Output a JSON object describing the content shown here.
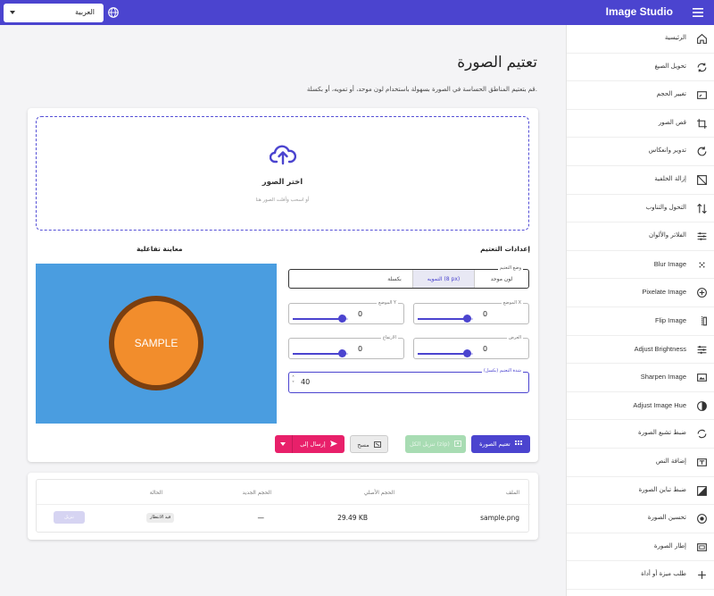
{
  "header": {
    "title": "Image Studio",
    "language": "العربية",
    "accent_color": "#4b44cf"
  },
  "sidebar": {
    "items": [
      {
        "label": "الرئيسية",
        "icon": "home-icon"
      },
      {
        "label": "تحويل الصيغ",
        "icon": "convert-icon"
      },
      {
        "label": "تغيير الحجم",
        "icon": "resize-icon"
      },
      {
        "label": "قص الصور",
        "icon": "crop-icon"
      },
      {
        "label": "تدوير وانعكاس",
        "icon": "rotate-icon"
      },
      {
        "label": "إزالة الخلفية",
        "icon": "background-remove-icon"
      },
      {
        "label": "التحول والتناوب",
        "icon": "transform-icon"
      },
      {
        "label": "الفلاتر والألوان",
        "icon": "filters-icon"
      },
      {
        "label": "Blur Image",
        "icon": "blur-icon"
      },
      {
        "label": "Pixelate Image",
        "icon": "pixelate-icon"
      },
      {
        "label": "Flip Image",
        "icon": "flip-icon"
      },
      {
        "label": "Adjust Brightness",
        "icon": "brightness-icon"
      },
      {
        "label": "Sharpen Image",
        "icon": "sharpen-icon"
      },
      {
        "label": "Adjust Image Hue",
        "icon": "hue-icon"
      },
      {
        "label": "ضبط تشبع الصورة",
        "icon": "saturation-icon"
      },
      {
        "label": "إضافة النص",
        "icon": "text-icon"
      },
      {
        "label": "ضبط تباين الصورة",
        "icon": "contrast-icon"
      },
      {
        "label": "تحسين الصورة",
        "icon": "enhance-icon"
      },
      {
        "label": "إطار الصورة",
        "icon": "frame-icon"
      },
      {
        "label": "طلب ميزة أو أداة",
        "icon": "plus-icon"
      }
    ]
  },
  "main": {
    "title": "تعتيم الصورة",
    "description": "قم بتعتيم المناطق الحساسة في الصورة بسهولة باستخدام لون موحد، أو تمويه، أو بكسلة.",
    "dropzone": {
      "title": "اختر الصور",
      "subtitle": "أو اسحب وأفلت الصور هنا"
    },
    "settings_heading": "إعدادات التعتيم",
    "preview_heading": "معاينة تفاعلية",
    "preview_text": "SAMPLE",
    "mode": {
      "label": "وضع التعتيم",
      "options": [
        "لون موحد",
        "التمويه (8 px)",
        "بكسلة"
      ],
      "selected": 1
    },
    "sliders": [
      {
        "label": "الموضع X",
        "value": "0",
        "level": 0.9
      },
      {
        "label": "الموضع Y",
        "value": "0",
        "level": 0.9
      },
      {
        "label": "العرض",
        "value": "0",
        "level": 0.9
      },
      {
        "label": "الارتفاع",
        "value": "0",
        "level": 0.9
      }
    ],
    "strength": {
      "label": "شدة التعتيم (بكسل)",
      "value": "40"
    },
    "buttons": {
      "apply": "تعتيم الصورة",
      "download": "تنزيل الكل (zip)",
      "clear": "مسح",
      "send": "إرسال إلى"
    }
  },
  "results": {
    "headers": [
      "الملف",
      "الحجم الأصلي",
      "الحجم الجديد",
      "الحالة"
    ],
    "rows": [
      {
        "file": "sample.png",
        "original_size": "29.49 KB",
        "new_size": "—",
        "status": "قيد الانتظار",
        "action": "تنزيل"
      }
    ]
  }
}
